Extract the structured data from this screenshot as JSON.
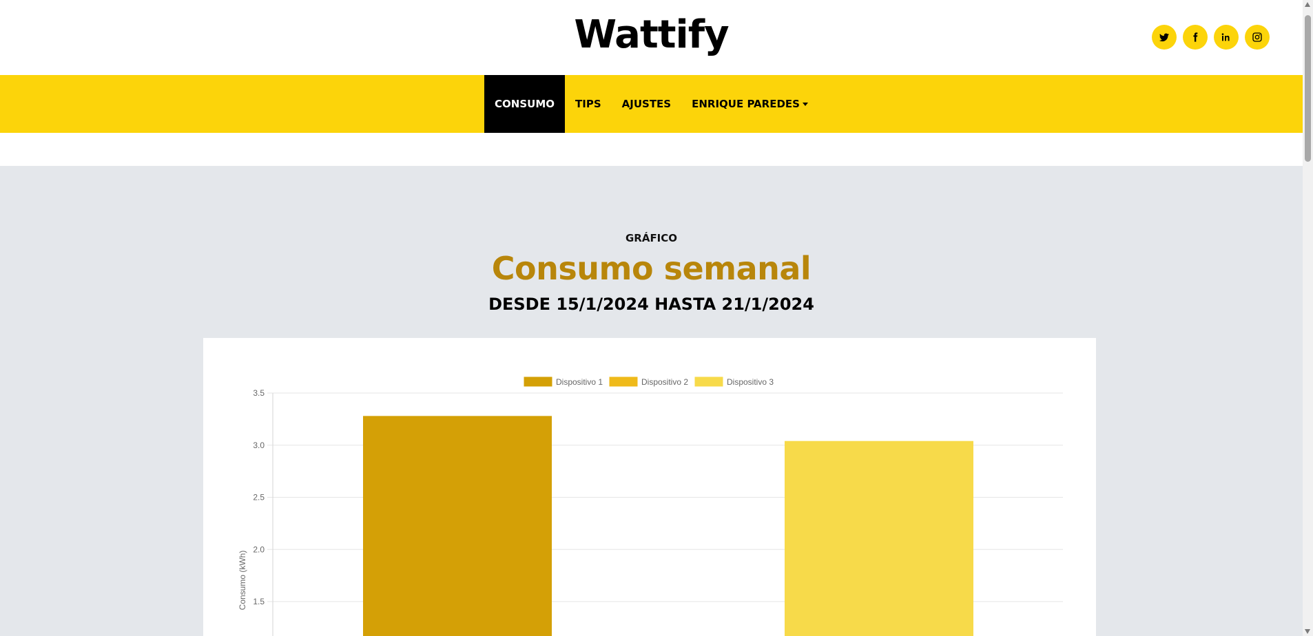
{
  "brand": {
    "name": "Wattify"
  },
  "social": [
    {
      "icon": "twitter-icon"
    },
    {
      "icon": "facebook-icon"
    },
    {
      "icon": "linkedin-icon"
    },
    {
      "icon": "instagram-icon"
    }
  ],
  "nav": {
    "items": [
      {
        "label": "CONSUMO",
        "active": true
      },
      {
        "label": "TIPS",
        "active": false
      },
      {
        "label": "AJUSTES",
        "active": false
      },
      {
        "label": "ENRIQUE PAREDES",
        "active": false,
        "dropdown": true
      }
    ]
  },
  "main": {
    "eyebrow": "GRÁFICO",
    "heading": "Consumo semanal",
    "range": "DESDE 15/1/2024 HASTA 21/1/2024"
  },
  "colors": {
    "accent": "#fcd40a",
    "heading": "#b8860b",
    "background": "#e4e7eb"
  },
  "chart_data": {
    "type": "bar",
    "ylabel": "Consumo (kWh)",
    "y_ticks": [
      "1.5",
      "2.0",
      "2.5",
      "3.0",
      "3.5"
    ],
    "ylim": [
      1.5,
      3.5
    ],
    "legend_position": "top",
    "grid": true,
    "series": [
      {
        "name": "Dispositivo 1",
        "color": "#d4a006",
        "value": 3.28,
        "slot": 0
      },
      {
        "name": "Dispositivo 2",
        "color": "#efba1a",
        "value": null,
        "slot": 1
      },
      {
        "name": "Dispositivo 3",
        "color": "#f7da4a",
        "value": 3.04,
        "slot": 2
      }
    ]
  }
}
